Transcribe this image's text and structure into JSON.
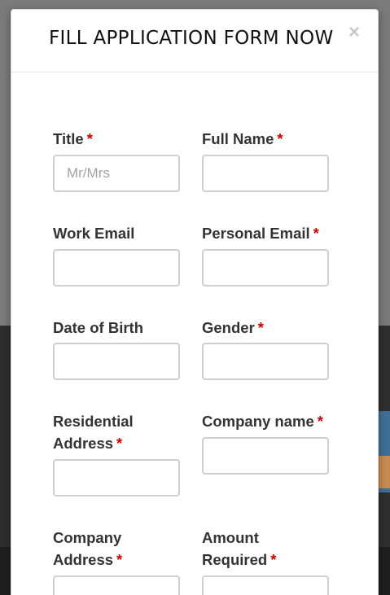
{
  "modal": {
    "title": "FILL APPLICATION FORM NOW",
    "close_label": "×"
  },
  "form": {
    "required_marker": "*",
    "fields": [
      {
        "label": "Title",
        "required": true,
        "placeholder": "Mr/Mrs",
        "value": ""
      },
      {
        "label": "Full Name",
        "required": true,
        "placeholder": "",
        "value": ""
      },
      {
        "label": "Work Email",
        "required": false,
        "placeholder": "",
        "value": ""
      },
      {
        "label": "Personal Email",
        "required": true,
        "placeholder": "",
        "value": ""
      },
      {
        "label": "Date of Birth",
        "required": false,
        "placeholder": "",
        "value": ""
      },
      {
        "label": "Gender",
        "required": true,
        "placeholder": "",
        "value": ""
      },
      {
        "label": "Residential Address",
        "required": true,
        "placeholder": "",
        "value": ""
      },
      {
        "label": "Company name",
        "required": true,
        "placeholder": "",
        "value": ""
      },
      {
        "label": "Company Address",
        "required": true,
        "placeholder": "",
        "value": ""
      },
      {
        "label": "Amount Required",
        "required": true,
        "placeholder": "",
        "value": ""
      }
    ]
  }
}
